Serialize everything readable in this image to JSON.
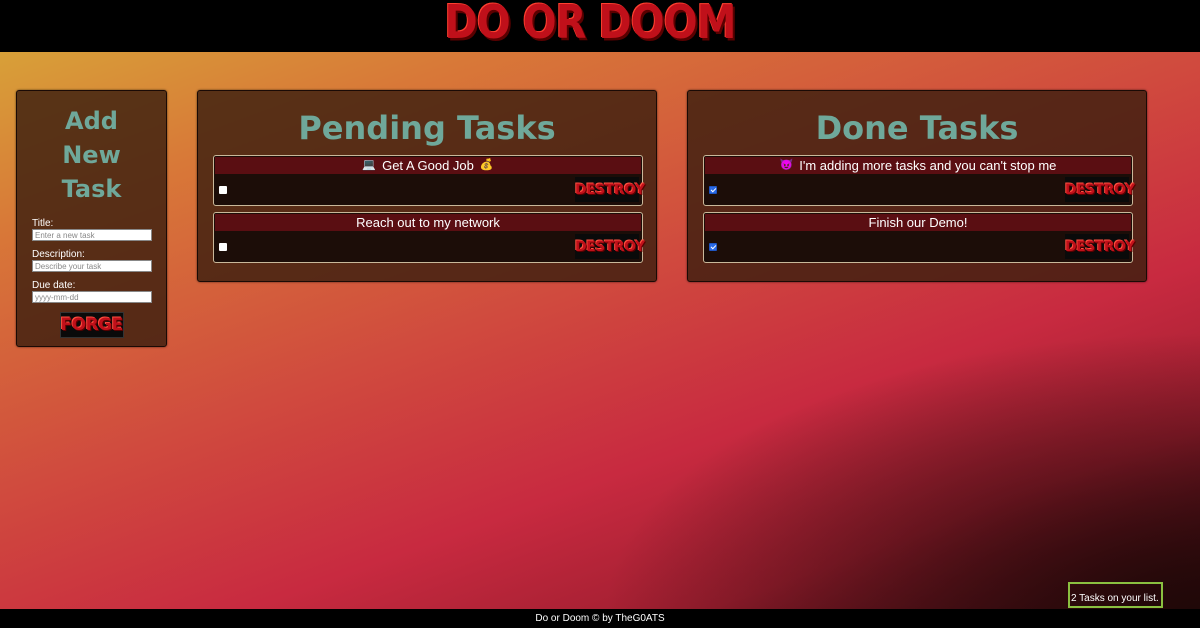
{
  "header": {
    "logo_text": "DO OR DOOM"
  },
  "add_task": {
    "title_lines": [
      "Add",
      "New",
      "Task"
    ],
    "title_label": "Title:",
    "title_placeholder": "Enter a new task",
    "description_label": "Description:",
    "description_placeholder": "Describe your task",
    "due_label": "Due date:",
    "due_placeholder": "yyyy-mm-dd",
    "submit_label": "FORGE"
  },
  "pending": {
    "heading": "Pending Tasks",
    "tasks": [
      {
        "title": "Get A Good Job",
        "icon_before": "💻",
        "icon_after": "💰",
        "done": false,
        "destroy_label": "DESTROY"
      },
      {
        "title": "Reach out to my network",
        "done": false,
        "destroy_label": "DESTROY"
      }
    ]
  },
  "done": {
    "heading": "Done Tasks",
    "tasks": [
      {
        "title": "I'm adding more tasks and you can't stop me",
        "icon_before": "😈",
        "done": true,
        "destroy_label": "DESTROY"
      },
      {
        "title": "Finish our Demo!",
        "done": true,
        "destroy_label": "DESTROY"
      }
    ]
  },
  "counter": {
    "text": "2 Tasks on your list."
  },
  "footer": {
    "text": "Do or Doom © by TheG0ATS"
  },
  "colors": {
    "heading_teal": "#6fa89a",
    "title_bar_red": "#5a0e12",
    "doom_red": "#c0101a",
    "counter_border": "#8ac040"
  }
}
